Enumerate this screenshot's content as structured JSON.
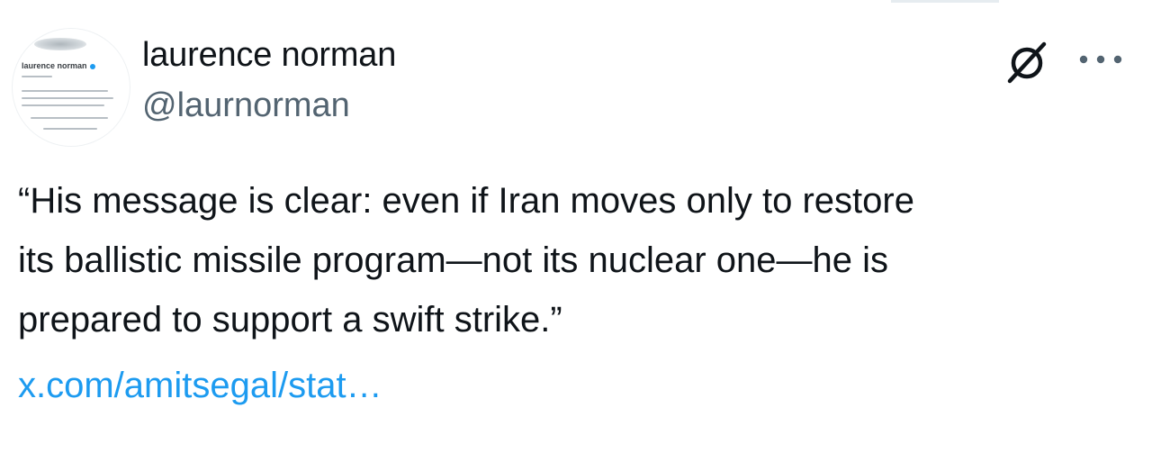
{
  "author": {
    "display_name": "laurence norman",
    "handle": "@laurnorman",
    "avatar_card": {
      "name": "laurence norman",
      "handle": "@laurnorman",
      "bio_lines": [
        "In Europe for The Wall Street Journal.",
        "nuclear, EU, European foreign policy",
        "that comes my way. My RT, someor"
      ],
      "stats": "Following  29.6K Follower"
    }
  },
  "actions": {
    "grok_icon": "grok-icon",
    "more_icon": "more-icon"
  },
  "tweet": {
    "lines": [
      "“His message is clear: even if Iran moves only to restore",
      "its ballistic missile program—not its nuclear one—he is",
      "prepared to support a swift strike.”"
    ],
    "link_text": "x.com/amitsegal/stat…"
  },
  "colors": {
    "text": "#0f1419",
    "muted": "#536471",
    "link": "#1d9bf0"
  }
}
